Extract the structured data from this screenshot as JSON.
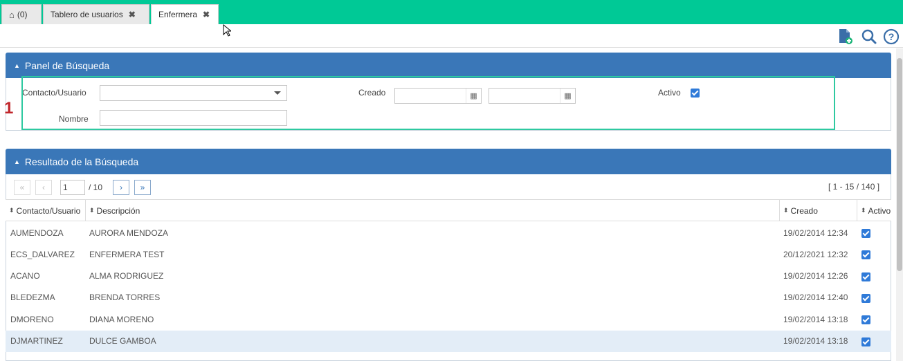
{
  "tabs": {
    "home_count": "(0)",
    "dashboard": "Tablero de usuarios",
    "active": "Enfermera",
    "close_glyph": "✖"
  },
  "search_panel": {
    "title": "Panel de Búsqueda",
    "contact_label": "Contacto/Usuario",
    "contact_value": "",
    "created_label": "Creado",
    "created_from": "",
    "created_to": "",
    "active_label": "Activo",
    "active_checked": true,
    "name_label": "Nombre",
    "name_value": ""
  },
  "annotation": {
    "step": "1"
  },
  "results_panel": {
    "title": "Resultado de la Búsqueda",
    "pager": {
      "page_value": "1",
      "page_total": "/ 10",
      "range": "[ 1 - 15 / 140 ]"
    },
    "columns": [
      "Contacto/Usuario",
      "Descripción",
      "Creado",
      "Activo"
    ],
    "rows": [
      {
        "user": "AUMENDOZA",
        "desc": "AURORA MENDOZA",
        "created": "19/02/2014 12:34",
        "active": true
      },
      {
        "user": "ECS_DALVAREZ",
        "desc": "ENFERMERA TEST",
        "created": "20/12/2021 12:32",
        "active": true
      },
      {
        "user": "ACANO",
        "desc": "ALMA RODRIGUEZ",
        "created": "19/02/2014 12:26",
        "active": true
      },
      {
        "user": "BLEDEZMA",
        "desc": "BRENDA TORRES",
        "created": "19/02/2014 12:40",
        "active": true
      },
      {
        "user": "DMORENO",
        "desc": "DIANA MORENO",
        "created": "19/02/2014 13:18",
        "active": true
      },
      {
        "user": "DJMARTINEZ",
        "desc": "DULCE GAMBOA",
        "created": "19/02/2014 13:18",
        "active": true
      }
    ]
  },
  "colors": {
    "tabbar": "#00c996",
    "panel_header": "#3a77b8",
    "checkbox": "#2f7ad8",
    "annotation": "#c0262b"
  },
  "icons": [
    "home-icon",
    "add-document-icon",
    "search-icon",
    "help-icon",
    "calendar-icon",
    "dropdown-arrow-icon",
    "sort-icon"
  ]
}
